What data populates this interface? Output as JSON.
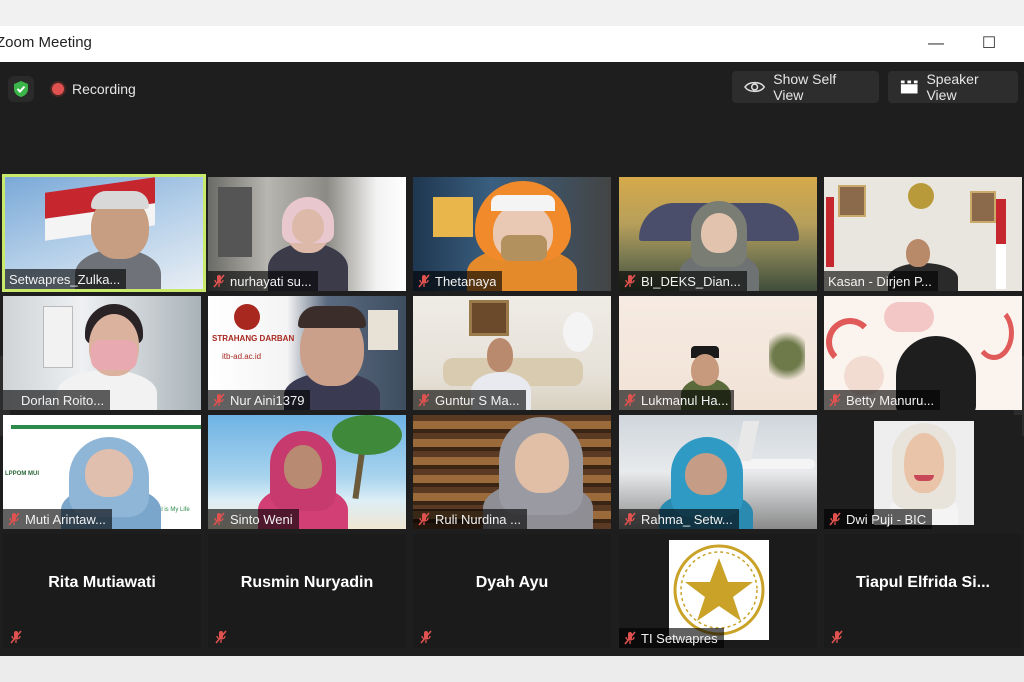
{
  "window": {
    "title": "Zoom Meeting",
    "minimize_glyph": "—",
    "maximize_glyph": "☐"
  },
  "toolbar": {
    "security_icon": "shield-check-icon",
    "recording_label": "Recording",
    "show_self_view_label": "Show Self View",
    "speaker_view_label": "Speaker View"
  },
  "colors": {
    "active_speaker_border": "#c9e96a",
    "mic_muted": "#e0524f",
    "recording_dot": "#e0524f",
    "shield": "#3bb54a"
  },
  "participants": [
    {
      "name": "Setwapres_Zulka...",
      "muted": false,
      "video": true,
      "active_speaker": true
    },
    {
      "name": "nurhayati su...",
      "muted": true,
      "video": true
    },
    {
      "name": "Thetanaya",
      "muted": true,
      "video": true
    },
    {
      "name": "BI_DEKS_Dian...",
      "muted": true,
      "video": true
    },
    {
      "name": "Kasan - Dirjen P...",
      "muted": false,
      "video": true
    },
    {
      "name": "Dorlan Roito...",
      "muted": false,
      "video": true
    },
    {
      "name": "Nur Aini1379",
      "muted": true,
      "video": true
    },
    {
      "name": "Guntur S Ma...",
      "muted": true,
      "video": true
    },
    {
      "name": "Lukmanul Ha...",
      "muted": true,
      "video": true
    },
    {
      "name": "Betty Manuru...",
      "muted": true,
      "video": true
    },
    {
      "name": "Muti Arintaw...",
      "muted": true,
      "video": true
    },
    {
      "name": "Sinto Weni",
      "muted": true,
      "video": true
    },
    {
      "name": "Ruli Nurdina ...",
      "muted": true,
      "video": true
    },
    {
      "name": "Rahma_ Setw...",
      "muted": true,
      "video": true
    },
    {
      "name": "Dwi Puji - BIC",
      "muted": true,
      "video": true
    },
    {
      "name": "Rita Mutiawati",
      "muted": true,
      "video": false
    },
    {
      "name": "Rusmin Nuryadin",
      "muted": true,
      "video": false
    },
    {
      "name": "Dyah Ayu",
      "muted": true,
      "video": false
    },
    {
      "name": "TI Setwapres",
      "muted": true,
      "video": true
    },
    {
      "name": "Tiapul  Elfrida  Si...",
      "muted": true,
      "video": false
    }
  ],
  "tile_text": {
    "nur_aini_sign": "STRAHANG DARBAN",
    "nur_aini_url": "itb-ad.ac.id",
    "muti_logo": "LPPOM MUI",
    "muti_tagline": "Halal is My Life"
  }
}
